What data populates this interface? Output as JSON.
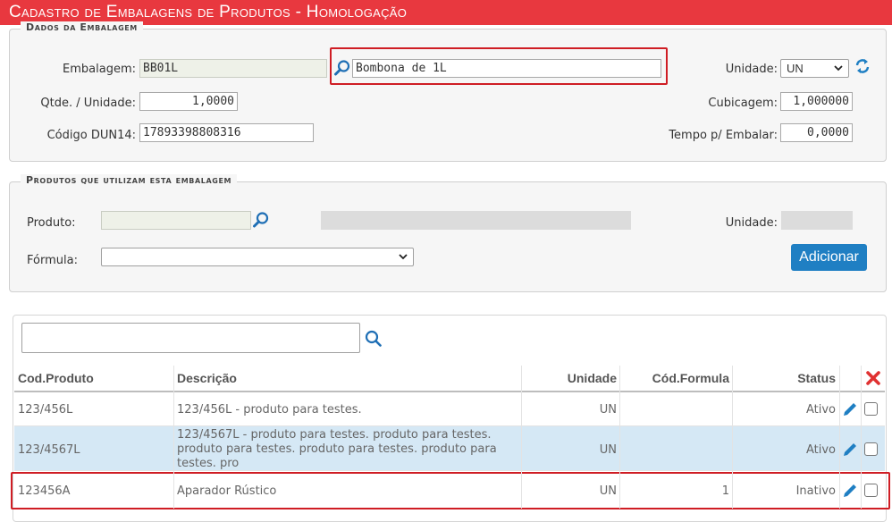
{
  "title": "Cadastro de Embalagens de Produtos  - Homologação",
  "dados": {
    "legend": "Dados da Embalagem",
    "embalagem_label": "Embalagem:",
    "embalagem_code": "BB01L",
    "embalagem_desc": "Bombona de 1L",
    "unidade_label": "Unidade:",
    "unidade_value": "UN",
    "qtde_label": "Qtde. / Unidade:",
    "qtde_value": "1,0000",
    "cubicagem_label": "Cubicagem:",
    "cubicagem_value": "1,000000",
    "dun_label": "Código DUN14:",
    "dun_value": "17893398808316",
    "tempo_label": "Tempo p/ Embalar:",
    "tempo_value": "0,0000"
  },
  "produtos": {
    "legend": "Produtos que utilizam esta embalagem",
    "produto_label": "Produto:",
    "unidade_label": "Unidade:",
    "formula_label": "Fórmula:",
    "add_button": "Adicionar"
  },
  "search": {
    "value": ""
  },
  "table": {
    "headers": [
      "Cod.Produto",
      "Descrição",
      "Unidade",
      "Cód.Formula",
      "Status"
    ],
    "rows": [
      {
        "cod": "123/456L",
        "desc": "123/456L - produto para testes.",
        "unidade": "UN",
        "formula": "",
        "status": "Ativo"
      },
      {
        "cod": "123/4567L",
        "desc": "123/4567L - produto para testes. produto para testes. produto para testes. produto para testes. produto para testes. pro",
        "unidade": "UN",
        "formula": "",
        "status": "Ativo"
      },
      {
        "cod": "123456A",
        "desc": "Aparador Rústico",
        "unidade": "UN",
        "formula": "1",
        "status": "Inativo"
      }
    ]
  },
  "colors": {
    "title_bg": "#e8383f",
    "accent": "#1f7fc3",
    "highlight": "#cf1d24",
    "selected_row": "#d5e8f5"
  }
}
